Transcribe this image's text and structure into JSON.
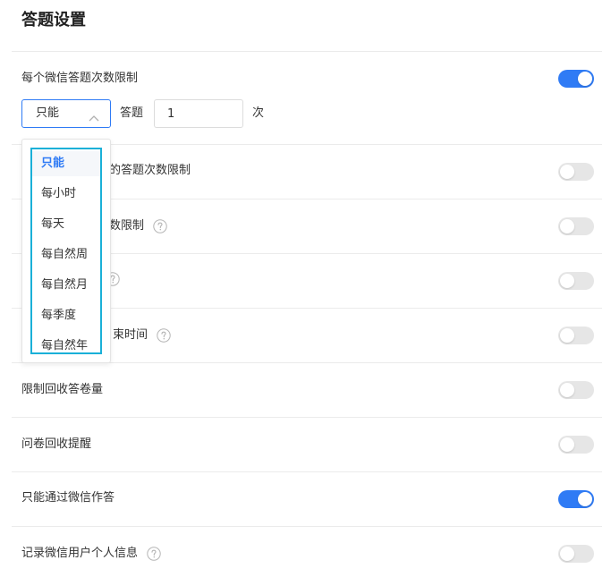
{
  "page": {
    "title": "答题设置"
  },
  "limit_section": {
    "label": "每个微信答题次数限制",
    "enabled": true,
    "select_value": "只能",
    "answer_label": "答题",
    "count_value": "1",
    "unit_label": "次"
  },
  "dropdown": {
    "options": [
      {
        "label": "只能",
        "selected": true
      },
      {
        "label": "每小时",
        "selected": false
      },
      {
        "label": "每天",
        "selected": false
      },
      {
        "label": "每自然周",
        "selected": false
      },
      {
        "label": "每自然月",
        "selected": false
      },
      {
        "label": "每季度",
        "selected": false
      },
      {
        "label": "每自然年",
        "selected": false
      }
    ]
  },
  "rows": [
    {
      "label_partial": "的答题次数限制",
      "enabled": false,
      "help": false
    },
    {
      "label_partial": "数限制",
      "enabled": false,
      "help": true
    },
    {
      "label_partial": "",
      "enabled": false,
      "help": true
    },
    {
      "label_partial": "束时间",
      "enabled": false,
      "help": true
    },
    {
      "label": "限制回收答卷量",
      "enabled": false,
      "help": false
    },
    {
      "label": "问卷回收提醒",
      "enabled": false,
      "help": false
    },
    {
      "label": "只能通过微信作答",
      "enabled": true,
      "help": false
    },
    {
      "label": "记录微信用户个人信息",
      "enabled": false,
      "help": true
    }
  ],
  "colors": {
    "accent": "#2f7bf5",
    "toggle_off": "#e6e6e6",
    "dropdown_highlight": "#1ab0d8"
  }
}
